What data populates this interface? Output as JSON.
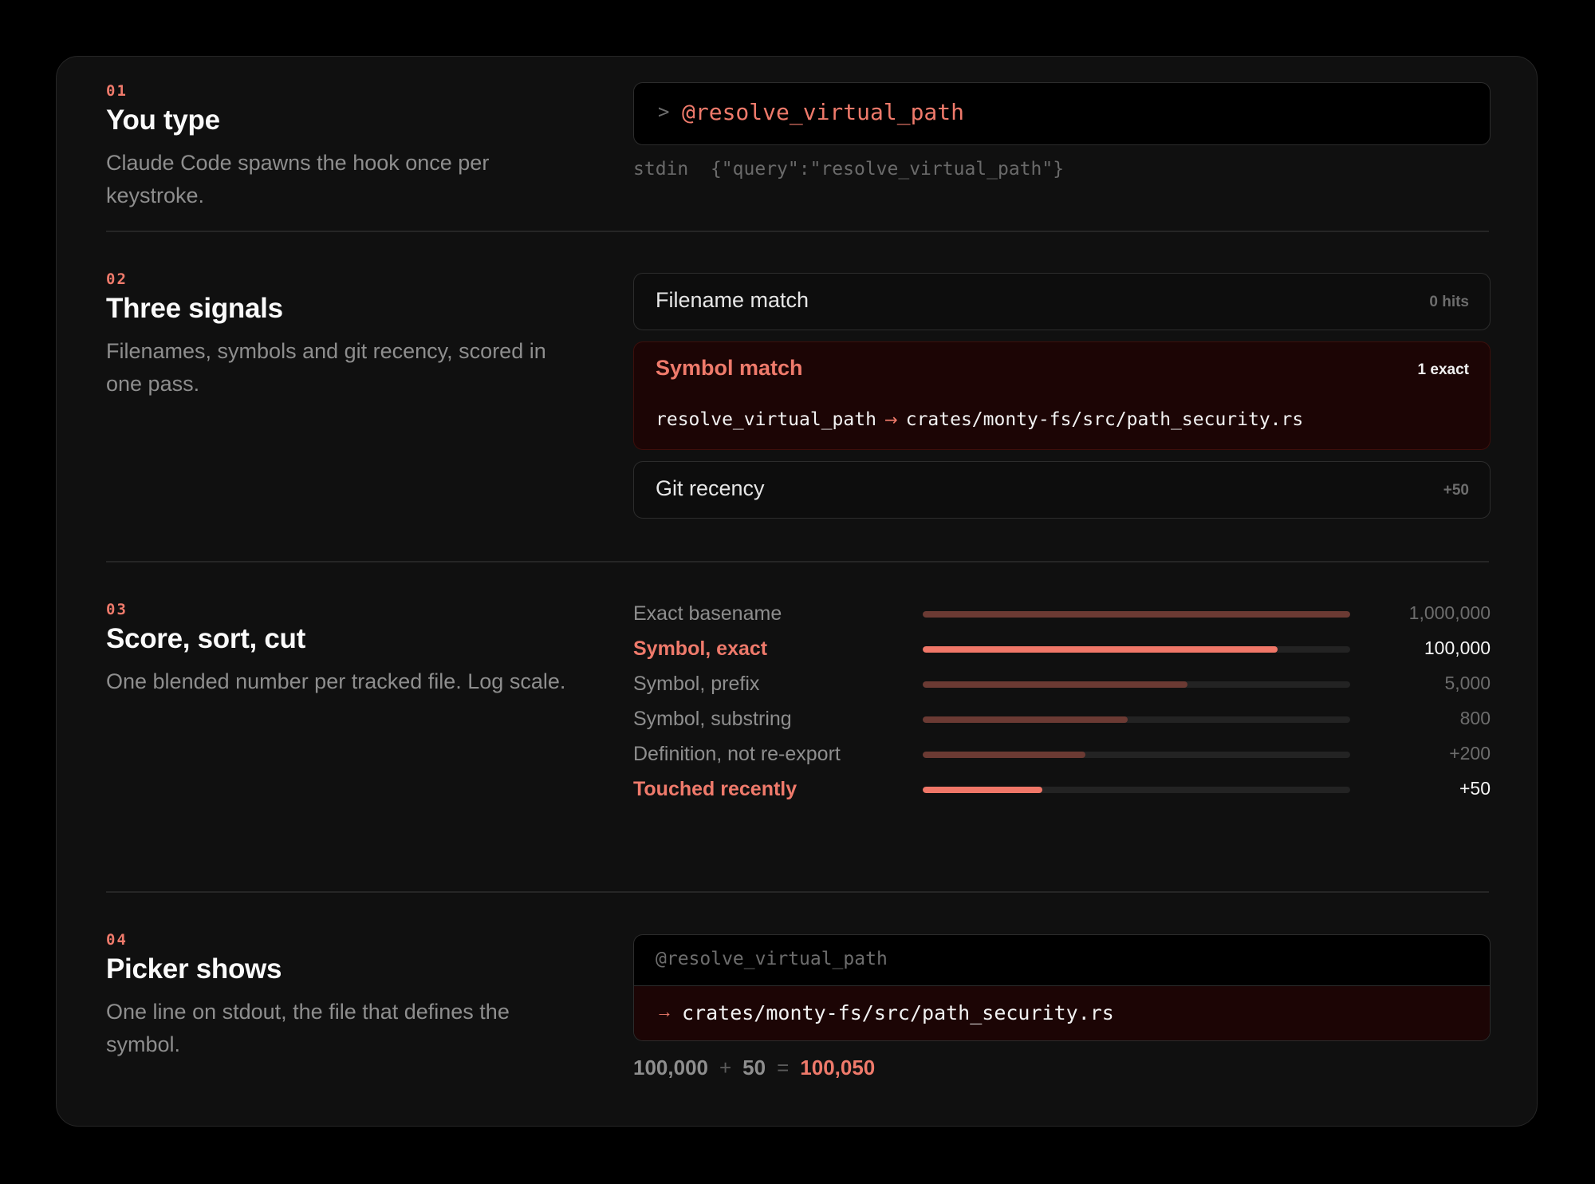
{
  "steps": [
    {
      "num": "01",
      "title": "You type",
      "desc": "Claude Code spawns the hook once per keystroke."
    },
    {
      "num": "02",
      "title": "Three signals",
      "desc": "Filenames, symbols and git recency, scored in one pass."
    },
    {
      "num": "03",
      "title": "Score, sort, cut",
      "desc": "One blended number per tracked file. Log scale."
    },
    {
      "num": "04",
      "title": "Picker shows",
      "desc": "One line on stdout, the file that defines the symbol."
    }
  ],
  "input": {
    "prompt": ">",
    "query": "@resolve_virtual_path",
    "stdin_label": "stdin",
    "stdin_json": "{\"query\":\"resolve_virtual_path\"}"
  },
  "signals": [
    {
      "label": "Filename match",
      "count": "0 hits"
    },
    {
      "label": "Symbol match",
      "count": "1 exact",
      "symbol": "resolve_virtual_path",
      "arrow": "→",
      "path": "crates/monty-fs/src/path_security.rs"
    },
    {
      "label": "Git recency",
      "count": "+50"
    }
  ],
  "scores": [
    {
      "label": "Exact basename",
      "value": "1,000,000",
      "fraction": 1.0,
      "highlight": false
    },
    {
      "label": "Symbol, exact",
      "value": "100,000",
      "fraction": 0.83,
      "highlight": true
    },
    {
      "label": "Symbol, prefix",
      "value": "5,000",
      "fraction": 0.62,
      "highlight": false
    },
    {
      "label": "Symbol, substring",
      "value": "800",
      "fraction": 0.48,
      "highlight": false
    },
    {
      "label": "Definition, not re-export",
      "value": "+200",
      "fraction": 0.38,
      "highlight": false
    },
    {
      "label": "Touched recently",
      "value": "+50",
      "fraction": 0.28,
      "highlight": true
    }
  ],
  "picker": {
    "query": "@resolve_virtual_path",
    "arrow": "→",
    "result": "crates/monty-fs/src/path_security.rs"
  },
  "sum": {
    "a": "100,000",
    "plus": "+",
    "b": "50",
    "eq": "=",
    "total": "100,050"
  },
  "colors": {
    "accent": "#ef7a6b",
    "background": "#000000",
    "card": "#101010",
    "highlight_bg": "#1c0505"
  }
}
